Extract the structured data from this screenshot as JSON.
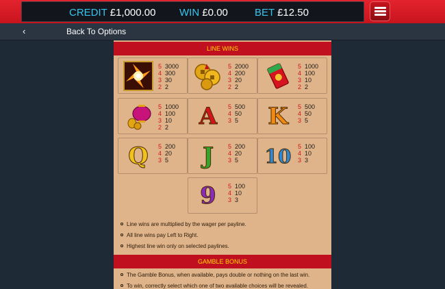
{
  "header": {
    "credit_label": "CREDIT",
    "credit_value": "£1,000.00",
    "win_label": "WIN",
    "win_value": "£0.00",
    "bet_label": "BET",
    "bet_value": "£12.50",
    "menu_icon": "hamburger-menu-icon"
  },
  "nav": {
    "back_icon": "chevron-left-icon",
    "back_label": "Back To Options"
  },
  "colors": {
    "top_bar": "#d81b24",
    "label_blue": "#34c6ee",
    "panel_bg": "#e0b48a",
    "banner_red": "#c01020",
    "banner_text": "#ffd800",
    "count_red": "#d2141c"
  },
  "paytable": {
    "line_wins_title": "LINE WINS",
    "symbols": [
      {
        "name": "fire-wild-symbol",
        "pays": [
          {
            "n": "5",
            "v": "3000"
          },
          {
            "n": "4",
            "v": "300"
          },
          {
            "n": "3",
            "v": "30"
          },
          {
            "n": "2",
            "v": "2"
          }
        ]
      },
      {
        "name": "gold-coins-symbol",
        "pays": [
          {
            "n": "5",
            "v": "2000"
          },
          {
            "n": "4",
            "v": "200"
          },
          {
            "n": "3",
            "v": "20"
          },
          {
            "n": "2",
            "v": "2"
          }
        ]
      },
      {
        "name": "red-envelope-symbol",
        "pays": [
          {
            "n": "5",
            "v": "1000"
          },
          {
            "n": "4",
            "v": "100"
          },
          {
            "n": "3",
            "v": "10"
          },
          {
            "n": "2",
            "v": "2"
          }
        ]
      },
      {
        "name": "lantern-symbol",
        "pays": [
          {
            "n": "5",
            "v": "1000"
          },
          {
            "n": "4",
            "v": "100"
          },
          {
            "n": "3",
            "v": "10"
          },
          {
            "n": "2",
            "v": "2"
          }
        ]
      },
      {
        "name": "ace-symbol",
        "letter": "A",
        "pays": [
          {
            "n": "5",
            "v": "500"
          },
          {
            "n": "4",
            "v": "50"
          },
          {
            "n": "3",
            "v": "5"
          }
        ]
      },
      {
        "name": "king-symbol",
        "letter": "K",
        "pays": [
          {
            "n": "5",
            "v": "500"
          },
          {
            "n": "4",
            "v": "50"
          },
          {
            "n": "3",
            "v": "5"
          }
        ]
      },
      {
        "name": "queen-symbol",
        "letter": "Q",
        "pays": [
          {
            "n": "5",
            "v": "200"
          },
          {
            "n": "4",
            "v": "20"
          },
          {
            "n": "3",
            "v": "5"
          }
        ]
      },
      {
        "name": "jack-symbol",
        "letter": "J",
        "pays": [
          {
            "n": "5",
            "v": "200"
          },
          {
            "n": "4",
            "v": "20"
          },
          {
            "n": "3",
            "v": "5"
          }
        ]
      },
      {
        "name": "ten-symbol",
        "letter": "10",
        "pays": [
          {
            "n": "5",
            "v": "100"
          },
          {
            "n": "4",
            "v": "10"
          },
          {
            "n": "3",
            "v": "3"
          }
        ]
      },
      {
        "name": "nine-symbol",
        "letter": "9",
        "pays": [
          {
            "n": "5",
            "v": "100"
          },
          {
            "n": "4",
            "v": "10"
          },
          {
            "n": "3",
            "v": "3"
          }
        ]
      }
    ],
    "notes": [
      "Line wins are multiplied by the wager per payline.",
      "All line wins pay Left to Right.",
      "Highest line win only on selected paylines."
    ],
    "gamble_title": "GAMBLE BONUS",
    "gamble_notes": [
      "The Gamble Bonus, when available, pays double or nothing on the last win.",
      "To win, correctly select which one of two available choices will be revealed."
    ]
  }
}
